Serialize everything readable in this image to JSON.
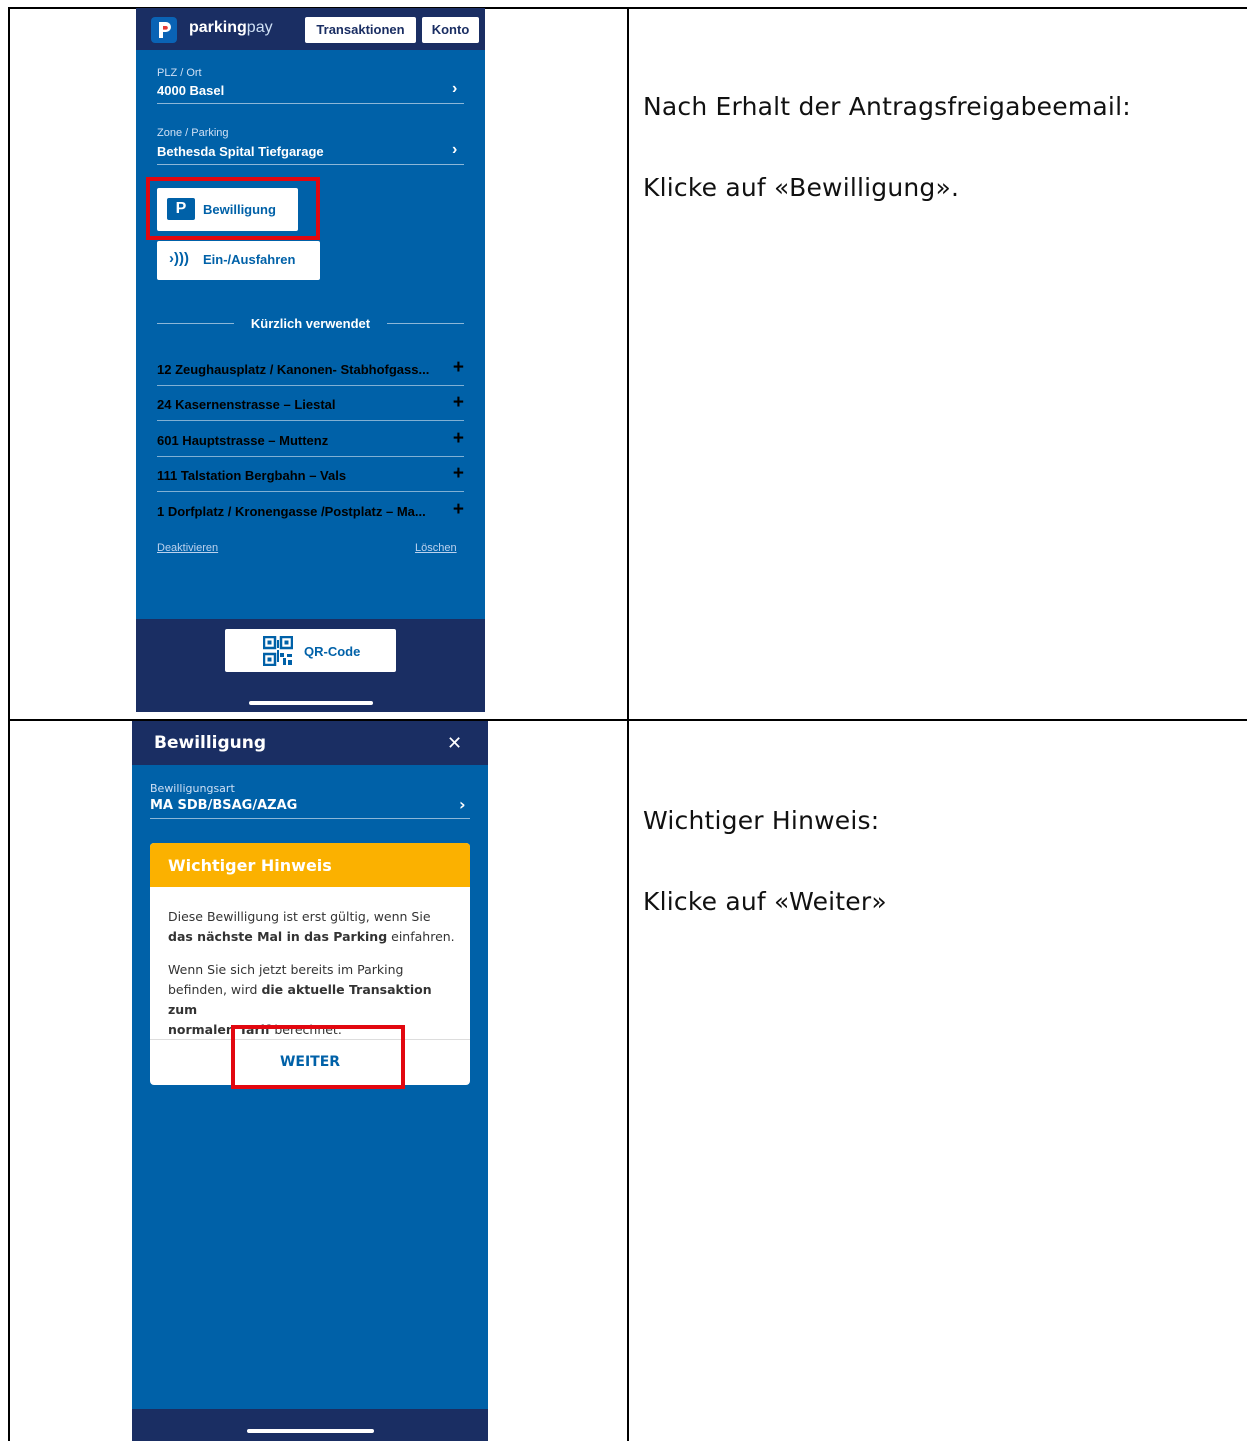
{
  "rows": [
    {
      "app": {
        "logo_text": "parking",
        "logo_text_light": "pay",
        "nav_transactions": "Transaktionen",
        "nav_account": "Konto",
        "plz_label": "PLZ / Ort",
        "plz_value": "4000 Basel",
        "zone_label": "Zone / Parking",
        "zone_value": "Bethesda Spital Tiefgarage",
        "permit_button": "Bewilligung",
        "permit_icon_letter": "P",
        "entry_button": "Ein-/Ausfahren",
        "recent_heading": "Kürzlich verwendet",
        "recent_items": [
          "12 Zeughausplatz / Kanonen- Stabhofgass...",
          "24 Kasernenstrasse – Liestal",
          "601 Hauptstrasse – Muttenz",
          "111 Talstation Bergbahn – Vals",
          "1 Dorfplatz / Kronengasse /Postplatz – Ma..."
        ],
        "deactivate_link": "Deaktivieren",
        "delete_link": "Löschen",
        "qr_button": "QR-Code"
      },
      "instruction_lines": [
        "Nach Erhalt der Antragsfreigabeemail:",
        "Klicke auf «Bewilligung»."
      ]
    },
    {
      "app": {
        "header_title": "Bewilligung",
        "close_symbol": "✕",
        "type_label": "Bewilligungsart",
        "type_value": "MA SDB/BSAG/AZAG",
        "notice_title": "Wichtiger Hinweis",
        "notice_p1_a": "Diese Bewilligung ist erst gültig, wenn Sie",
        "notice_p1_b_bold": "das nächste Mal in das Parking",
        "notice_p1_c": " einfahren.",
        "notice_p2_a": "Wenn Sie sich jetzt bereits im Parking",
        "notice_p2_b": "befinden, wird ",
        "notice_p2_c_bold": "die aktuelle Transaktion zum",
        "notice_p2_d_bold": "normalen Tarif",
        "notice_p2_e": " berechnet.",
        "continue_button": "WEITER"
      },
      "instruction_lines": [
        "Wichtiger Hinweis:",
        "Klicke auf «Weiter»"
      ]
    }
  ],
  "colors": {
    "app_blue": "#0061a8",
    "header_navy": "#1a2e63",
    "notice_yellow": "#fbb100",
    "highlight_red": "#e2070f"
  }
}
